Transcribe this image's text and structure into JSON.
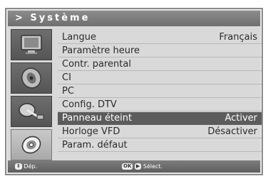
{
  "title": "> Système",
  "menu": {
    "items": [
      {
        "label": "Langue",
        "value": "Français"
      },
      {
        "label": "Paramètre heure",
        "value": ""
      },
      {
        "label": "Contr. parental",
        "value": ""
      },
      {
        "label": "CI",
        "value": ""
      },
      {
        "label": "PC",
        "value": ""
      },
      {
        "label": "Config. DTV",
        "value": ""
      },
      {
        "label": "Panneau éteint",
        "value": "Activer"
      },
      {
        "label": "Horloge VFD",
        "value": "Désactiver"
      },
      {
        "label": "Param. défaut",
        "value": ""
      }
    ],
    "selected_index": 6
  },
  "sidebar": {
    "icons": [
      "monitor-icon",
      "speaker-icon",
      "satellite-dish-icon",
      "disc-icon"
    ],
    "active_index": 3
  },
  "footer": {
    "move_label": "Dép.",
    "ok_key": "OK",
    "select_label": "Sélect."
  }
}
